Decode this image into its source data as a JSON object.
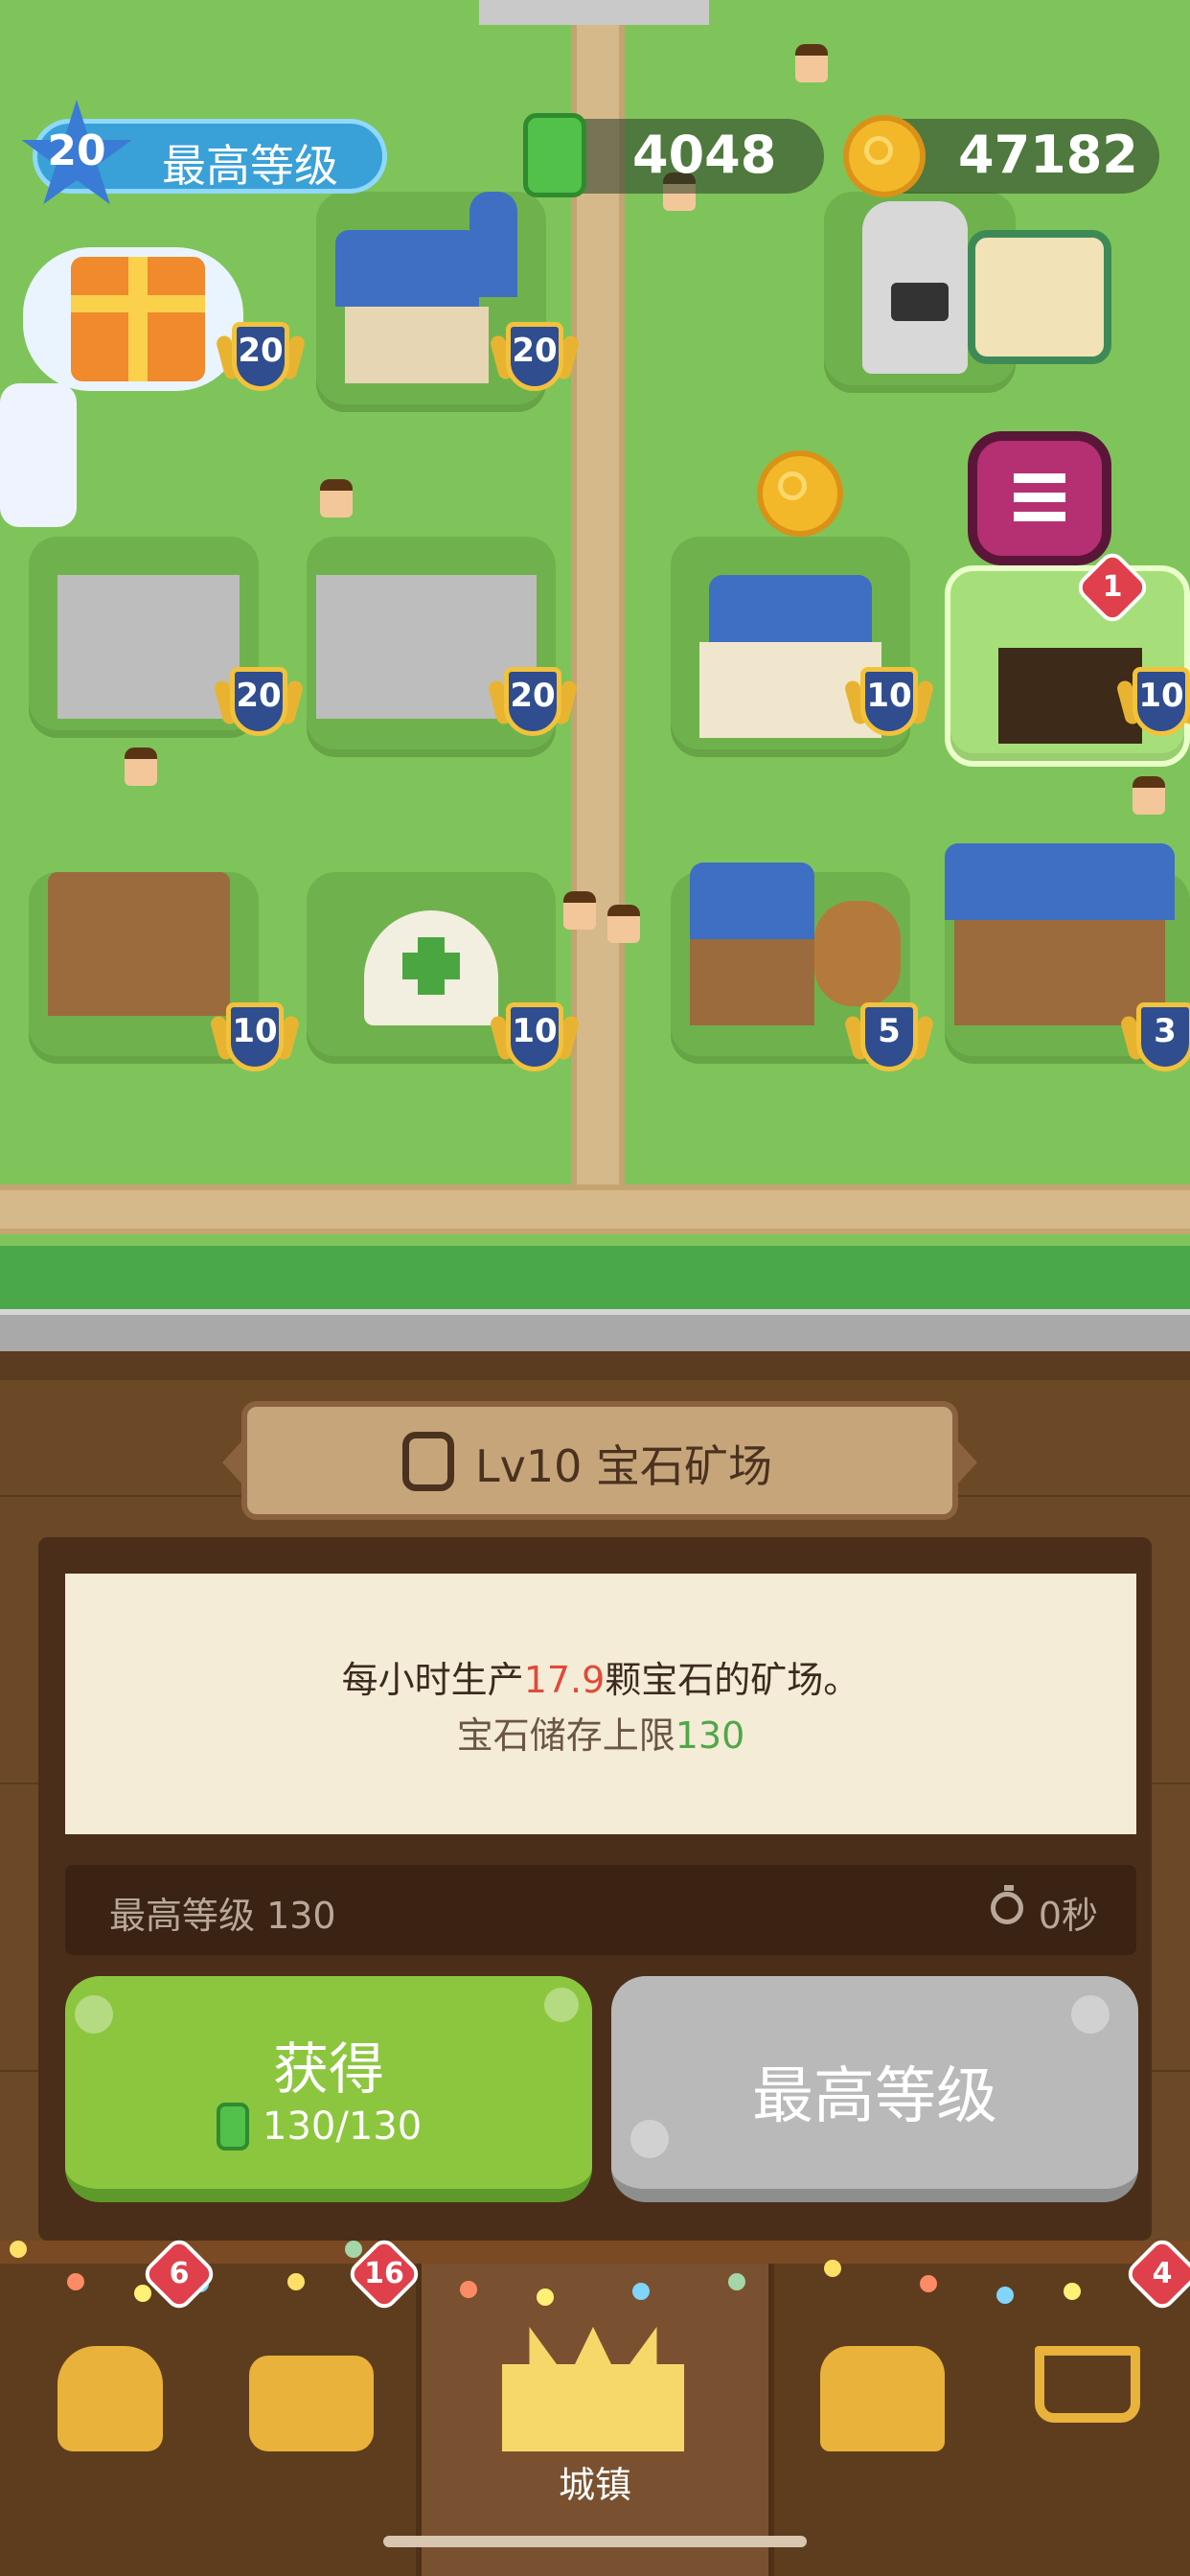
{
  "hud": {
    "star_level": "20",
    "star_label": "最高等级",
    "gems": "4048",
    "coins": "47182"
  },
  "map": {
    "badges": [
      "20",
      "20",
      "20",
      "20",
      "10",
      "10",
      "10",
      "10",
      "5",
      "3"
    ],
    "notification_count": "1"
  },
  "panel": {
    "title": "Lv10 宝石矿场",
    "desc_prefix": "每小时生产",
    "desc_rate": "17.9",
    "desc_suffix": "颗宝石的矿场。",
    "limit_prefix": "宝石储存上限",
    "limit_value": "130",
    "info_left": "最高等级 130",
    "info_right": "0秒",
    "get_label": "获得",
    "get_count": "130/130",
    "max_label": "最高等级"
  },
  "nav": {
    "active_label": "城镇",
    "badges": {
      "heroes": "6",
      "team": "16",
      "shop": "4"
    }
  },
  "colors": {
    "grass": "#7fc45a",
    "panel_wood": "#6b4826",
    "get_green": "#8cc63f",
    "max_gray": "#b9b9b9",
    "rate_red": "#e04a3a",
    "limit_green": "#4fa74a"
  }
}
